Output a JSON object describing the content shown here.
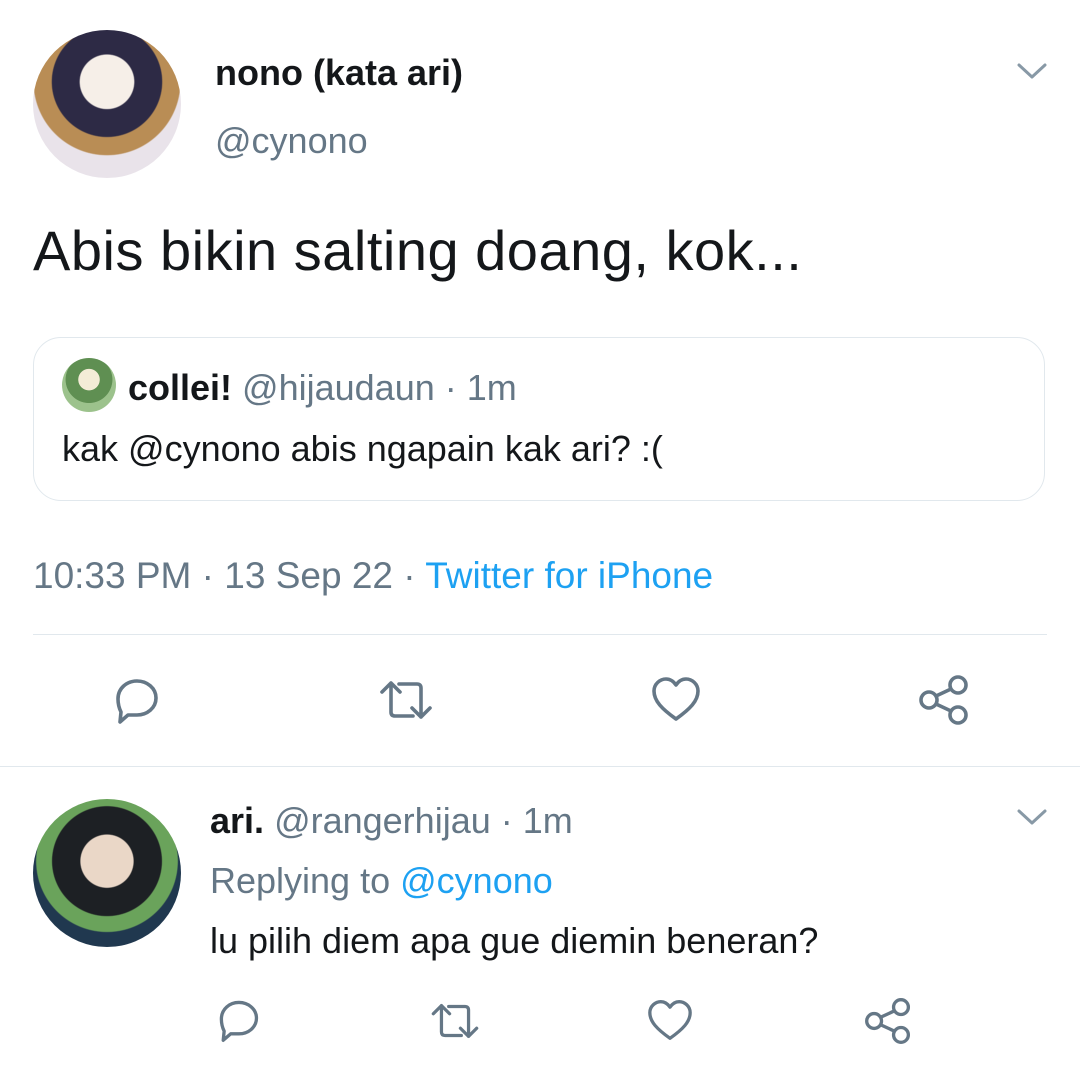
{
  "main_tweet": {
    "display_name": "nono (kata ari)",
    "handle": "@cynono",
    "text": "Abis bikin salting doang, kok...",
    "quoted": {
      "display_name": "collei!",
      "handle": "@hijaudaun",
      "separator": "·",
      "time": "1m",
      "text": "kak @cynono abis ngapain kak ari? :("
    },
    "time": "10:33 PM",
    "separator": "·",
    "date": "13 Sep 22",
    "separator2": "·",
    "source": "Twitter for iPhone",
    "menu_icon": "chevron-down-icon",
    "actions": [
      "reply-icon",
      "retweet-icon",
      "like-icon",
      "share-icon"
    ]
  },
  "reply_tweet": {
    "display_name": "ari.",
    "handle": "@rangerhijau",
    "separator": "·",
    "time": "1m",
    "replying_prefix": "Replying to",
    "replying_handle": "@cynono",
    "text": "lu pilih diem apa gue diemin beneran?",
    "menu_icon": "chevron-down-icon",
    "actions": [
      "reply-icon",
      "retweet-icon",
      "like-icon",
      "share-icon"
    ]
  },
  "colors": {
    "text": "#14171a",
    "secondary": "#657786",
    "accent": "#1da1f2",
    "divider": "#e1e8ed"
  }
}
